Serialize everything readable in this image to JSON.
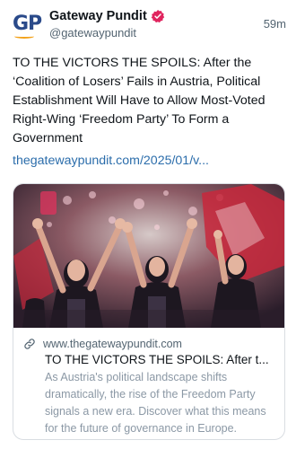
{
  "post": {
    "display_name": "Gateway Pundit",
    "avatar_text": "GP",
    "handle": "@gatewaypundit",
    "timestamp": "59m",
    "text": "TO THE VICTORS THE SPOILS: After the ‘Coalition of Losers’ Fails in Austria, Political Establishment Will Have to Allow Most-Voted Right-Wing ‘Freedom Party’ To Form a Government",
    "link": "thegatewaypundit.com/2025/01/v..."
  },
  "card": {
    "domain": "www.thegatewaypundit.com",
    "title": "TO THE VICTORS THE SPOILS: After t...",
    "description": "As Austria's political landscape shifts dramatically, the rise of the Freedom Party signals a new era. Discover what this means for the future of governance in Europe."
  },
  "colors": {
    "verified_badge": "#e0245e",
    "link": "#2b6dab",
    "avatar_text": "#2a4a8a",
    "avatar_swoosh": "#f3a21b"
  },
  "icons": {
    "verified": "verified-badge-icon",
    "link": "link-icon"
  }
}
